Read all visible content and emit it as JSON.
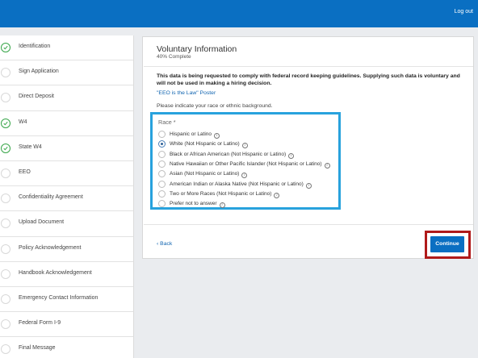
{
  "header": {
    "logout_label": "Log out"
  },
  "sidebar": {
    "items": [
      {
        "label": "Identification",
        "complete": true
      },
      {
        "label": "Sign Application",
        "complete": false
      },
      {
        "label": "Direct Deposit",
        "complete": false
      },
      {
        "label": "W4",
        "complete": true
      },
      {
        "label": "State W4",
        "complete": true
      },
      {
        "label": "EEO",
        "complete": false
      },
      {
        "label": "Confidentiality Agreement",
        "complete": false
      },
      {
        "label": "Upload Document",
        "complete": false
      },
      {
        "label": "Policy Acknowledgement",
        "complete": false
      },
      {
        "label": "Handbook Acknowledgement",
        "complete": false
      },
      {
        "label": "Emergency Contact Information",
        "complete": false
      },
      {
        "label": "Federal Form I-9",
        "complete": false
      },
      {
        "label": "Final Message",
        "complete": false
      }
    ]
  },
  "main": {
    "title": "Voluntary Information",
    "progress": "40% Complete",
    "notice": "This data is being requested to comply with federal record keeping guidelines. Supplying such data is voluntary and will not be used in making a hiring decision.",
    "poster_link": "\"EEO is the Law\" Poster",
    "prompt": "Please indicate your race or ethnic background.",
    "race": {
      "label": "Race *",
      "selected_index": 1,
      "options": [
        "Hispanic or Latino",
        "White (Not Hispanic or Latino)",
        "Black or African American (Not Hispanic or Latino)",
        "Native Hawaiian or Other Pacific Islander (Not Hispanic or Latino)",
        "Asian (Not Hispanic or Latino)",
        "American Indian or Alaska Native (Not Hispanic or Latino)",
        "Two or More Races (Not Hispanic or Latino)",
        "Prefer not to answer"
      ]
    },
    "back_label": "Back",
    "continue_label": "Continue"
  },
  "colors": {
    "header_blue": "#0a6fc2",
    "highlight_box": "#28a2dd",
    "continue_outline": "#b01a1a",
    "complete_green": "#37a548",
    "link_blue": "#1064b0"
  }
}
